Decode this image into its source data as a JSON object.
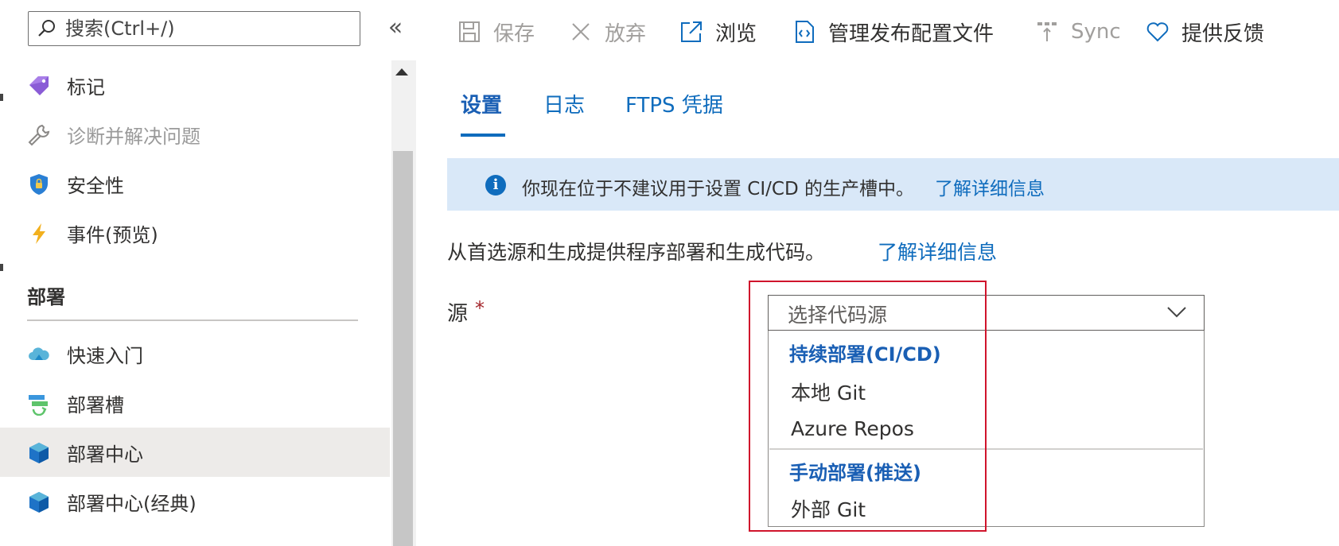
{
  "search": {
    "placeholder": "搜索(Ctrl+/)"
  },
  "collapse_label": "«",
  "nav": {
    "items_top": [
      {
        "label": "标记",
        "icon": "tag-icon"
      },
      {
        "label": "诊断并解决问题",
        "icon": "wrench-icon",
        "disabled": true
      },
      {
        "label": "安全性",
        "icon": "shield-icon"
      },
      {
        "label": "事件(预览)",
        "icon": "lightning-icon"
      }
    ],
    "section_title": "部署",
    "items_deploy": [
      {
        "label": "快速入门",
        "icon": "cloud-icon"
      },
      {
        "label": "部署槽",
        "icon": "deployment-slots-icon"
      },
      {
        "label": "部署中心",
        "icon": "cube-icon",
        "selected": true
      },
      {
        "label": "部署中心(经典)",
        "icon": "cube-icon"
      }
    ]
  },
  "toolbar": {
    "save": "保存",
    "discard": "放弃",
    "browse": "浏览",
    "manage_profile": "管理发布配置文件",
    "sync": "Sync",
    "feedback": "提供反馈"
  },
  "tabs": [
    "设置",
    "日志",
    "FTPS 凭据"
  ],
  "info_banner": {
    "text": "你现在位于不建议用于设置 CI/CD 的生产槽中。",
    "link": "了解详细信息"
  },
  "description": {
    "text": "从首选源和生成提供程序部署和生成代码。",
    "link": "了解详细信息"
  },
  "source_field": {
    "label": "源",
    "required_mark": "*",
    "placeholder": "选择代码源",
    "groups": [
      {
        "header": "持续部署(CI/CD)",
        "options": [
          "本地 Git",
          "Azure Repos"
        ]
      },
      {
        "header": "手动部署(推送)",
        "options": [
          "外部 Git"
        ]
      }
    ]
  },
  "colors": {
    "accent": "#0f6cbd",
    "banner_bg": "#d9e8f8",
    "highlight": "#d0142c",
    "required": "#a4262c"
  }
}
